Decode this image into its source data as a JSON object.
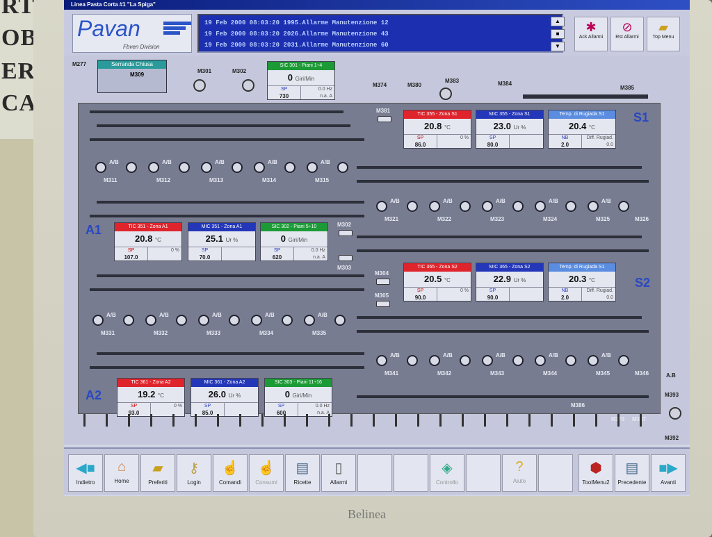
{
  "window": {
    "title": "Linea Pasta Corta #1 \"La Spiga\""
  },
  "logo": {
    "brand": "Pavan",
    "division": "Fbven Division"
  },
  "alarms": [
    "19 Feb 2000 08:03:20 1995.Allarme Manutenzione 12",
    "19 Feb 2000 08:03:20 2026.Allarme Manutenzione 43",
    "19 Feb 2000 08:03:20 2031.Allarme Manutenzione 60"
  ],
  "header_buttons": {
    "ack": "Ack Allarmi",
    "reset": "Rst Allarmi",
    "top": "Top Menu"
  },
  "zones": {
    "s1": "S1",
    "s2": "S2",
    "a1": "A1",
    "a2": "A2"
  },
  "top": {
    "m277": "M277",
    "serranda": "Serranda Chiusa",
    "m309": "M309",
    "m301": "M301",
    "m302": "M302",
    "m374": "M374",
    "m380": "M380",
    "m383": "M383",
    "m384": "M384",
    "m385": "M385",
    "m381": "M381",
    "sic301": {
      "title": "SIC 301 - Piani 1÷4",
      "value": "0",
      "unit": "Giri/Min",
      "sp_label": "SP",
      "sp": "730",
      "r1": "0.0 Hz",
      "r2": "n.a. A"
    }
  },
  "panels": {
    "tic355": {
      "title": "TIC 355 - Zona S1",
      "value": "20.8",
      "unit": "°C",
      "sp_label": "SP",
      "sp": "86.0",
      "r1": "0 %",
      "r2": ""
    },
    "mic355": {
      "title": "MIC 355 - Zona S1",
      "value": "23.0",
      "unit": "Ur %",
      "sp_label": "SP",
      "sp": "80.0",
      "r1": "",
      "r2": ""
    },
    "trug1": {
      "title": "Temp. di Rugiada S1",
      "value": "20.4",
      "unit": "°C",
      "sp_label": "NB",
      "sp": "2.0",
      "r1": "Diff. Rugiad.",
      "r2": "0.0"
    },
    "tic351": {
      "title": "TIC 351 - Zona A1",
      "value": "20.8",
      "unit": "°C",
      "sp_label": "SP",
      "sp": "107.0",
      "r1": "0 %",
      "r2": ""
    },
    "mic351": {
      "title": "MIC 351 - Zona A1",
      "value": "25.1",
      "unit": "Ur %",
      "sp_label": "SP",
      "sp": "70.0",
      "r1": "",
      "r2": ""
    },
    "sic302": {
      "title": "SIC 302 - Piani 5÷10",
      "value": "0",
      "unit": "Giri/Min",
      "sp_label": "SP",
      "sp": "620",
      "r1": "0.0 Hz",
      "r2": "n.a. A"
    },
    "tic365": {
      "title": "TIC 365 - Zona S2",
      "value": "20.5",
      "unit": "°C",
      "sp_label": "SP",
      "sp": "90.0",
      "r1": "0 %",
      "r2": ""
    },
    "mic365": {
      "title": "MIC 365 - Zona S2",
      "value": "22.9",
      "unit": "Ur %",
      "sp_label": "SP",
      "sp": "90.0",
      "r1": "",
      "r2": ""
    },
    "trug2": {
      "title": "Temp. di Rugiada S1",
      "value": "20.3",
      "unit": "°C",
      "sp_label": "NB",
      "sp": "2.0",
      "r1": "Diff. Rugiad.",
      "r2": "0.0"
    },
    "tic361": {
      "title": "TIC 361 - Zona A2",
      "value": "19.2",
      "unit": "°C",
      "sp_label": "SP",
      "sp": "93.0",
      "r1": "0 %",
      "r2": ""
    },
    "mic361": {
      "title": "MIC 361 - Zona A2",
      "value": "26.0",
      "unit": "Ur %",
      "sp_label": "SP",
      "sp": "85.0",
      "r1": "",
      "r2": ""
    },
    "sic303": {
      "title": "SIC 303 - Piani 11÷16",
      "value": "0",
      "unit": "Giri/Min",
      "sp_label": "SP",
      "sp": "600",
      "r1": "0.0 Hz",
      "r2": "n.a. A"
    }
  },
  "roller_tag": "A/B",
  "rows": {
    "r1": [
      "M311",
      "M312",
      "M313",
      "M314",
      "M315"
    ],
    "r2": [
      "M321",
      "M322",
      "M323",
      "M324",
      "M325",
      "M326"
    ],
    "r3": [
      "M331",
      "M332",
      "M333",
      "M334",
      "M335"
    ],
    "r4": [
      "M341",
      "M342",
      "M343",
      "M344",
      "M345",
      "M346"
    ]
  },
  "side": {
    "m302": "M302",
    "m303": "M303",
    "m304": "M304",
    "m305": "M305",
    "m386": "M386",
    "m370": "R370",
    "m387": "M387",
    "m393": "M393",
    "m392": "M392",
    "ab": "A.B"
  },
  "toolbar": {
    "back": "Indietro",
    "home": "Home",
    "prefs": "Preferiti",
    "login": "Login",
    "commands": "Comandi",
    "consumi": "Consumi",
    "recipes": "Ricette",
    "alarms": "Allarmi",
    "control": "Controllo",
    "help": "Aiuto",
    "toolmenu2": "ToolMenu2",
    "prev": "Precedente",
    "next": "Avanti"
  },
  "bezel_brand": "Belinea",
  "wall_sign": [
    "RTS",
    "OBI",
    "ERE",
    "CA"
  ]
}
